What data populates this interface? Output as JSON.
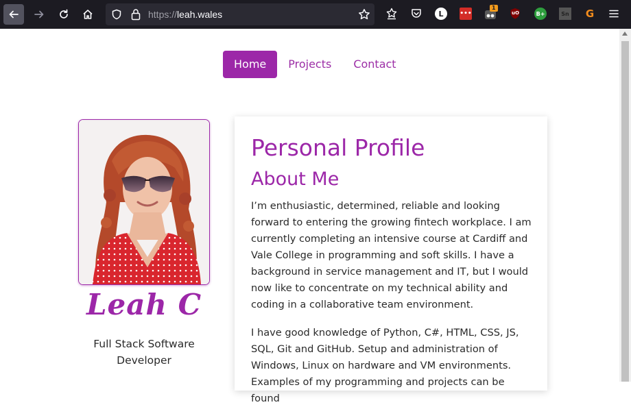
{
  "browser": {
    "url_protocol": "https://",
    "url_host": "leah.wales",
    "extensions": [
      {
        "name": "profile-l",
        "glyph": "L",
        "bg": "#ffffff",
        "fg": "#1c1b22"
      },
      {
        "name": "lastpass",
        "glyph": "•••",
        "bg": "#d32d27",
        "fg": "#ffffff"
      },
      {
        "name": "tampermonkey",
        "glyph": "",
        "bg": "#3a3a3a",
        "fg": "#ffffff",
        "badge": "1"
      },
      {
        "name": "ublock-origin",
        "glyph": "uO",
        "bg": "#800000",
        "fg": "#ffffff"
      },
      {
        "name": "bplus",
        "glyph": "B+",
        "bg": "#2e9e3e",
        "fg": "#ffffff"
      },
      {
        "name": "sn",
        "glyph": "Sn",
        "bg": "#555555",
        "fg": "#222222"
      },
      {
        "name": "grammarly",
        "glyph": "G",
        "bg": "#1c1b22",
        "fg": "#f28c1d"
      }
    ]
  },
  "nav": {
    "items": [
      {
        "label": "Home",
        "active": true
      },
      {
        "label": "Projects",
        "active": false
      },
      {
        "label": "Contact",
        "active": false
      }
    ]
  },
  "profile": {
    "signature": "Leah C",
    "job_title_line1": "Full Stack Software",
    "job_title_line2": "Developer"
  },
  "content": {
    "title": "Personal Profile",
    "subtitle": "About Me",
    "paragraph1": "I’m enthusiastic, determined, reliable and looking forward to entering the growing fintech workplace. I am currently completing an intensive course at Cardiff and Vale College in programming and soft skills. I have a background in service management and IT, but I would now like to concentrate on my technical ability and coding in a collaborative team environment.",
    "paragraph2": "I have good knowledge of Python, C#, HTML, CSS, JS, SQL, Git and GitHub. Setup and administration of Windows, Linux on hardware and VM environments. Examples of my programming and projects can be found"
  },
  "colors": {
    "accent": "#9c27a8",
    "chrome_bg": "#1c1b22",
    "urlbar_bg": "#2b2a33"
  }
}
